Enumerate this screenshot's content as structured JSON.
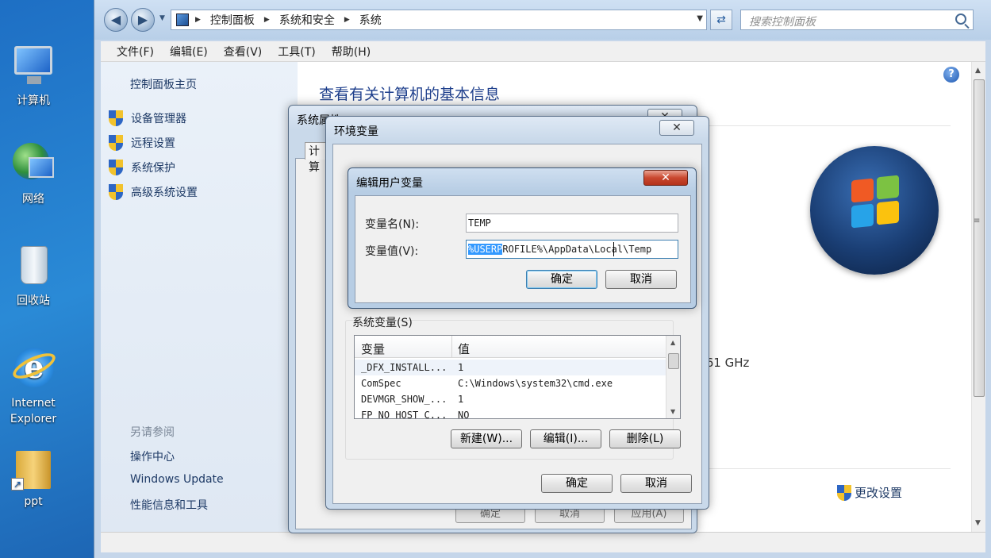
{
  "desktop": {
    "icons": [
      {
        "name": "computer",
        "label": "计算机"
      },
      {
        "name": "network",
        "label": "网络"
      },
      {
        "name": "recycle",
        "label": "回收站"
      },
      {
        "name": "ie",
        "label": "Internet Explorer"
      },
      {
        "name": "ppt",
        "label": "ppt"
      }
    ]
  },
  "address_bar": {
    "breadcrumb": [
      "控制面板",
      "系统和安全",
      "系统"
    ],
    "search_placeholder": "搜索控制面板"
  },
  "menu": [
    "文件(F)",
    "编辑(E)",
    "查看(V)",
    "工具(T)",
    "帮助(H)"
  ],
  "left_pane": {
    "home": "控制面板主页",
    "tasks": [
      "设备管理器",
      "远程设置",
      "系统保护",
      "高级系统设置"
    ],
    "see_also_title": "另请参阅",
    "see_also": [
      "操作中心",
      "Windows Update",
      "性能信息和工具"
    ]
  },
  "content": {
    "title": "查看有关计算机的基本信息",
    "cpu_speed_fragment": ".61 GHz",
    "change_settings": "更改设置"
  },
  "system_properties": {
    "title": "系统属性",
    "tab": "计算",
    "buttons": [
      "确定",
      "取消",
      "应用(A)"
    ]
  },
  "env_vars": {
    "title": "环境变量",
    "system_vars_label": "系统变量(S)",
    "columns": [
      "变量",
      "值"
    ],
    "rows": [
      {
        "name": "_DFX_INSTALL...",
        "value": "1"
      },
      {
        "name": "ComSpec",
        "value": "C:\\Windows\\system32\\cmd.exe"
      },
      {
        "name": "DEVMGR_SHOW_...",
        "value": "1"
      },
      {
        "name": "FP_NO_HOST_C...",
        "value": "NO"
      }
    ],
    "buttons": {
      "new": "新建(W)...",
      "edit": "编辑(I)...",
      "delete": "删除(L)"
    },
    "ok": "确定",
    "cancel": "取消"
  },
  "edit_user_var": {
    "title": "编辑用户变量",
    "name_label": "变量名(N):",
    "name_value": "TEMP",
    "value_label": "变量值(V):",
    "value_selected": "%USERP",
    "value_rest": "ROFILE%\\AppData\\Local\\Temp",
    "ok": "确定",
    "cancel": "取消"
  },
  "colors": {
    "accent_title": "#1e3f8c",
    "selection": "#3399ff"
  }
}
